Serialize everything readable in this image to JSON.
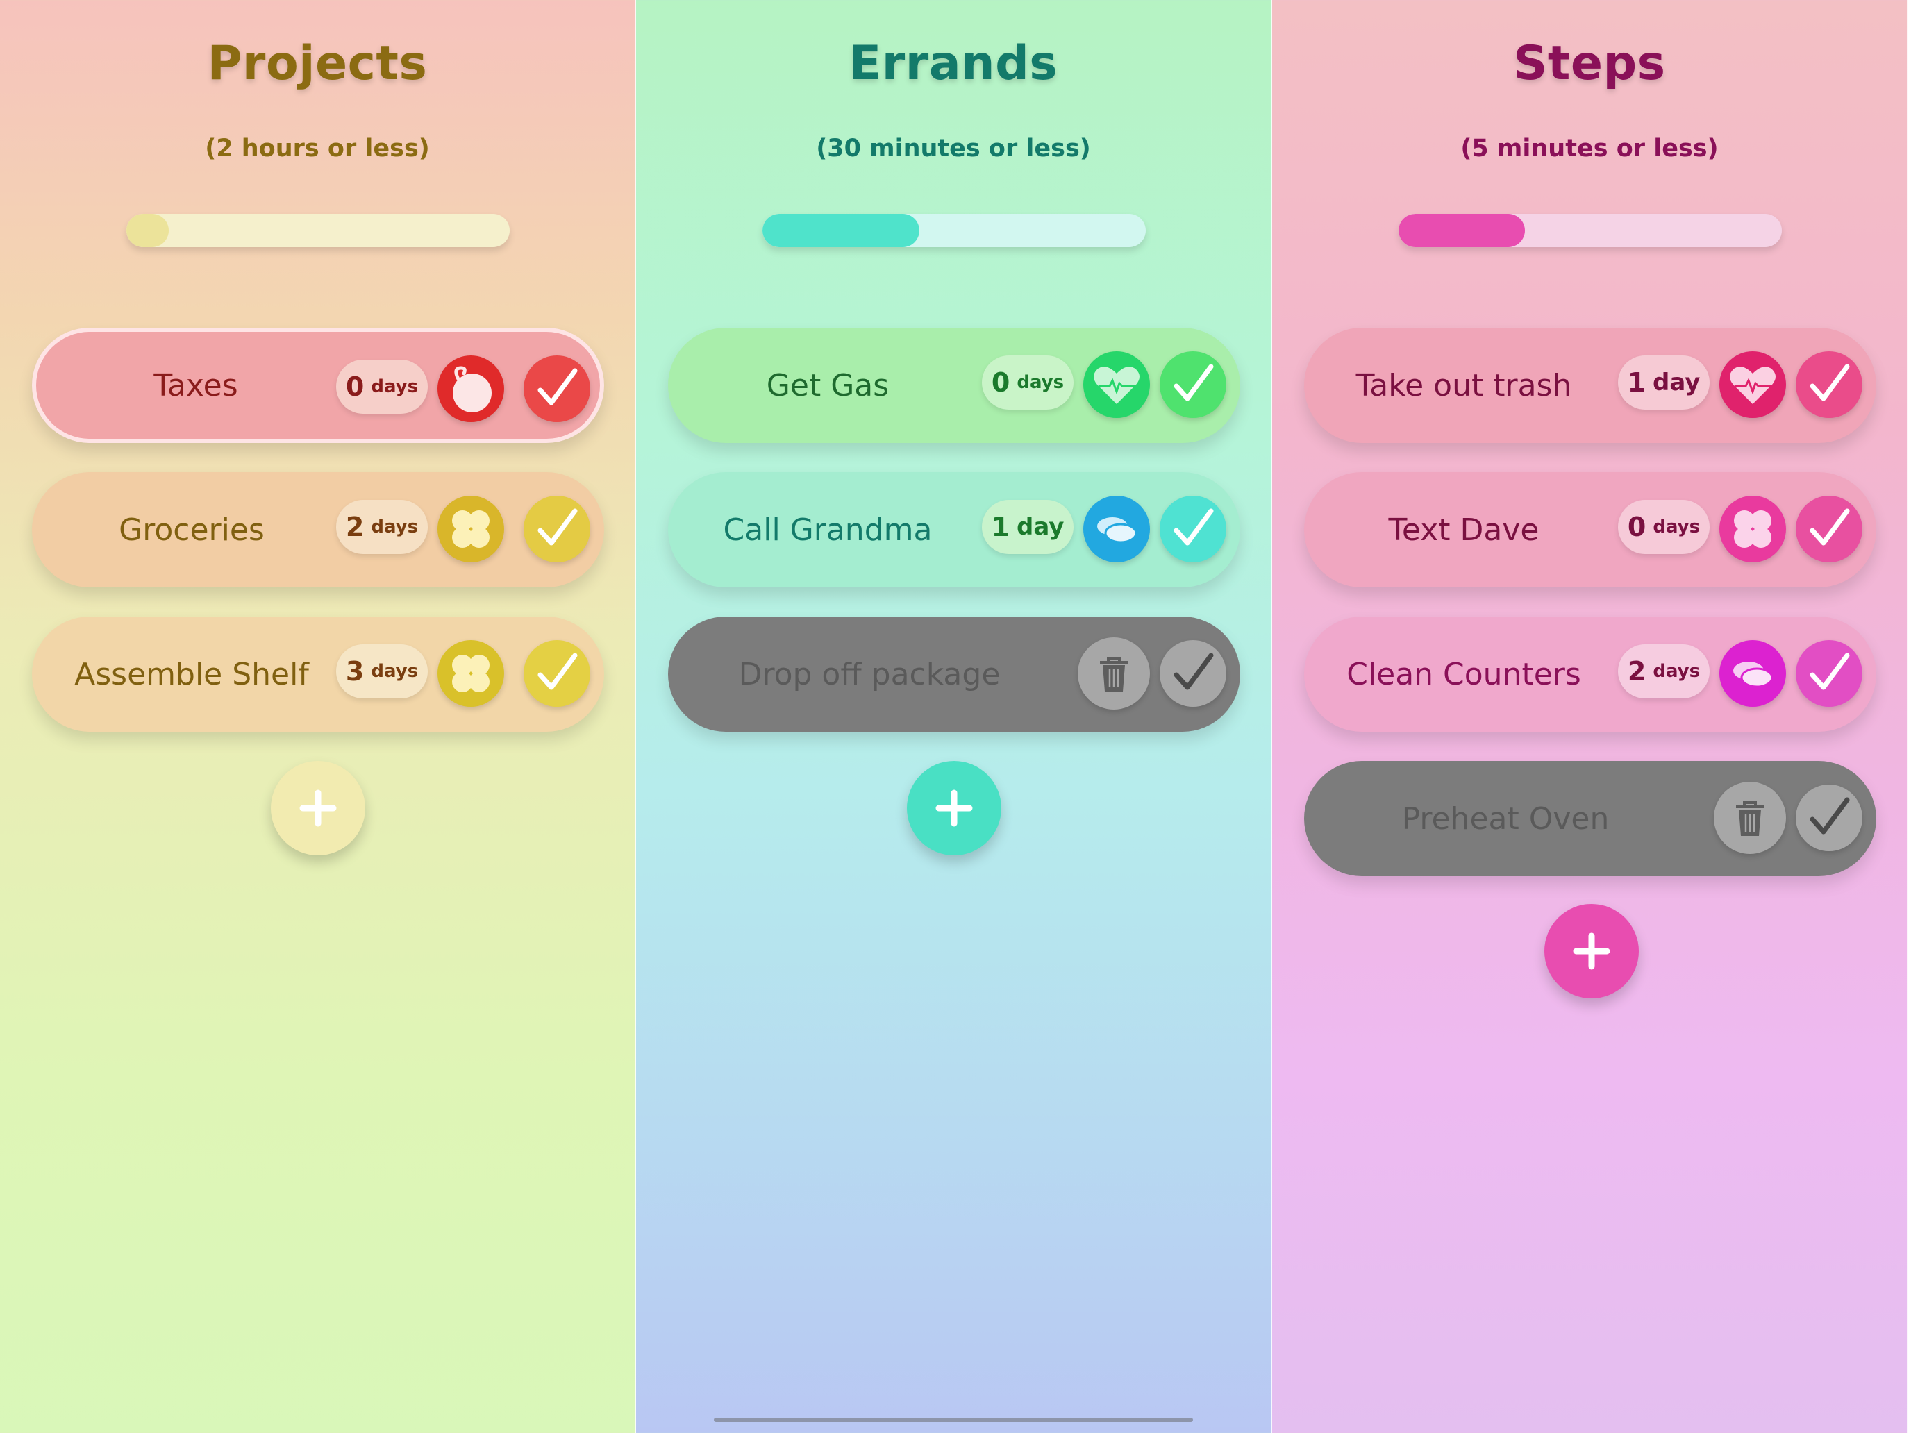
{
  "columns": [
    {
      "id": "projects",
      "title": "Projects",
      "subtitle": "(2 hours or less)",
      "progress": 0.11,
      "colors": {
        "title": "#8b6b12",
        "track": "#f5f0cc",
        "fill": "#ece39a",
        "add": "#f2ebb0"
      },
      "tasks": [
        {
          "label": "Taxes",
          "days_num": "0",
          "days_unit": "days",
          "icon": "bomb-icon",
          "done": false,
          "selected": true,
          "colors": {
            "bg": "#f1a5a8",
            "text": "#8a1b1b",
            "chip": "#f6cfc9",
            "chip_text": "#8a1b1b",
            "icon_bg": "#e02a2a",
            "check_bg": "#ea4848"
          }
        },
        {
          "label": "Groceries",
          "days_num": "2",
          "days_unit": "days",
          "icon": "clover-icon",
          "done": false,
          "selected": false,
          "colors": {
            "bg": "#f2cda4",
            "text": "#806010",
            "chip": "#f6e0c4",
            "chip_text": "#7a3e10",
            "icon_bg": "#d9b62a",
            "check_bg": "#e4cb44"
          }
        },
        {
          "label": "Assemble Shelf",
          "days_num": "3",
          "days_unit": "days",
          "icon": "clover-icon",
          "done": false,
          "selected": false,
          "colors": {
            "bg": "#f2d6a8",
            "text": "#806010",
            "chip": "#f6e6c6",
            "chip_text": "#7a3e10",
            "icon_bg": "#d9c12a",
            "check_bg": "#e4d044"
          }
        }
      ]
    },
    {
      "id": "errands",
      "title": "Errands",
      "subtitle": "(30 minutes or less)",
      "progress": 0.41,
      "colors": {
        "title": "#137a6a",
        "track": "#d2f7f0",
        "fill": "#4fe3cb",
        "add": "#49e0c4"
      },
      "tasks": [
        {
          "label": "Get Gas",
          "days_num": "0",
          "days_unit": "days",
          "icon": "heart-pulse-icon",
          "done": false,
          "selected": false,
          "colors": {
            "bg": "#a9eeab",
            "text": "#1e6a2e",
            "chip": "#c9f4c8",
            "chip_text": "#1b7a2c",
            "icon_bg": "#26d66a",
            "check_bg": "#4fe26e"
          }
        },
        {
          "label": "Call Grandma",
          "days_num": "1",
          "days_unit": "day",
          "icon": "coins-icon",
          "done": false,
          "selected": false,
          "colors": {
            "bg": "#a4edd0",
            "text": "#137a6a",
            "chip": "#c8f3cc",
            "chip_text": "#1b7a2c",
            "icon_bg": "#22a8e0",
            "check_bg": "#4fe2d2"
          }
        },
        {
          "label": "Drop off package",
          "icon": "trash-icon",
          "done": true,
          "selected": false,
          "colors": {
            "bg": "#7c7c7c",
            "text": "#5a5a5a",
            "icon_bg": "#a7a7a7",
            "check_bg": "#a7a7a7"
          }
        }
      ]
    },
    {
      "id": "steps",
      "title": "Steps",
      "subtitle": "(5 minutes or less)",
      "progress": 0.33,
      "colors": {
        "title": "#8a1058",
        "track": "#f5d3e6",
        "fill": "#e84db0",
        "add": "#e84db0"
      },
      "tasks": [
        {
          "label": "Take out trash",
          "days_num": "1",
          "days_unit": "day",
          "icon": "heart-pulse-icon",
          "done": false,
          "selected": false,
          "colors": {
            "bg": "#f0a5b8",
            "text": "#7a1040",
            "chip": "#f6cad4",
            "chip_text": "#7a1040",
            "icon_bg": "#e0226c",
            "check_bg": "#ea4c8a"
          }
        },
        {
          "label": "Text Dave",
          "days_num": "0",
          "days_unit": "days",
          "icon": "clover-icon",
          "done": false,
          "selected": false,
          "colors": {
            "bg": "#f0a6c0",
            "text": "#7a1040",
            "chip": "#f6cad8",
            "chip_text": "#7a1040",
            "icon_bg": "#e93a9e",
            "check_bg": "#e850a0"
          }
        },
        {
          "label": "Clean Counters",
          "days_num": "2",
          "days_unit": "days",
          "icon": "coins-icon",
          "done": false,
          "selected": false,
          "colors": {
            "bg": "#f0a8cc",
            "text": "#8a1058",
            "chip": "#f6cce0",
            "chip_text": "#7a1040",
            "icon_bg": "#dc22d0",
            "check_bg": "#e24ec4"
          }
        },
        {
          "label": "Preheat Oven",
          "icon": "trash-icon",
          "done": true,
          "selected": false,
          "colors": {
            "bg": "#7c7c7c",
            "text": "#5a5a5a",
            "icon_bg": "#a7a7a7",
            "check_bg": "#a7a7a7"
          }
        }
      ]
    }
  ]
}
